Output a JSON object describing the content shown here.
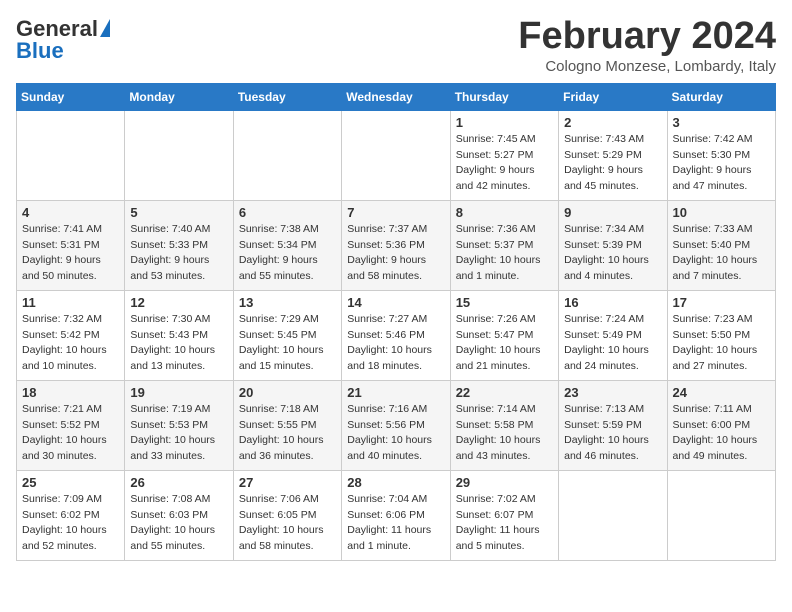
{
  "header": {
    "logo_general": "General",
    "logo_blue": "Blue",
    "month_title": "February 2024",
    "subtitle": "Cologno Monzese, Lombardy, Italy"
  },
  "days_of_week": [
    "Sunday",
    "Monday",
    "Tuesday",
    "Wednesday",
    "Thursday",
    "Friday",
    "Saturday"
  ],
  "weeks": [
    [
      {
        "day": "",
        "info": ""
      },
      {
        "day": "",
        "info": ""
      },
      {
        "day": "",
        "info": ""
      },
      {
        "day": "",
        "info": ""
      },
      {
        "day": "1",
        "info": "Sunrise: 7:45 AM\nSunset: 5:27 PM\nDaylight: 9 hours\nand 42 minutes."
      },
      {
        "day": "2",
        "info": "Sunrise: 7:43 AM\nSunset: 5:29 PM\nDaylight: 9 hours\nand 45 minutes."
      },
      {
        "day": "3",
        "info": "Sunrise: 7:42 AM\nSunset: 5:30 PM\nDaylight: 9 hours\nand 47 minutes."
      }
    ],
    [
      {
        "day": "4",
        "info": "Sunrise: 7:41 AM\nSunset: 5:31 PM\nDaylight: 9 hours\nand 50 minutes."
      },
      {
        "day": "5",
        "info": "Sunrise: 7:40 AM\nSunset: 5:33 PM\nDaylight: 9 hours\nand 53 minutes."
      },
      {
        "day": "6",
        "info": "Sunrise: 7:38 AM\nSunset: 5:34 PM\nDaylight: 9 hours\nand 55 minutes."
      },
      {
        "day": "7",
        "info": "Sunrise: 7:37 AM\nSunset: 5:36 PM\nDaylight: 9 hours\nand 58 minutes."
      },
      {
        "day": "8",
        "info": "Sunrise: 7:36 AM\nSunset: 5:37 PM\nDaylight: 10 hours\nand 1 minute."
      },
      {
        "day": "9",
        "info": "Sunrise: 7:34 AM\nSunset: 5:39 PM\nDaylight: 10 hours\nand 4 minutes."
      },
      {
        "day": "10",
        "info": "Sunrise: 7:33 AM\nSunset: 5:40 PM\nDaylight: 10 hours\nand 7 minutes."
      }
    ],
    [
      {
        "day": "11",
        "info": "Sunrise: 7:32 AM\nSunset: 5:42 PM\nDaylight: 10 hours\nand 10 minutes."
      },
      {
        "day": "12",
        "info": "Sunrise: 7:30 AM\nSunset: 5:43 PM\nDaylight: 10 hours\nand 13 minutes."
      },
      {
        "day": "13",
        "info": "Sunrise: 7:29 AM\nSunset: 5:45 PM\nDaylight: 10 hours\nand 15 minutes."
      },
      {
        "day": "14",
        "info": "Sunrise: 7:27 AM\nSunset: 5:46 PM\nDaylight: 10 hours\nand 18 minutes."
      },
      {
        "day": "15",
        "info": "Sunrise: 7:26 AM\nSunset: 5:47 PM\nDaylight: 10 hours\nand 21 minutes."
      },
      {
        "day": "16",
        "info": "Sunrise: 7:24 AM\nSunset: 5:49 PM\nDaylight: 10 hours\nand 24 minutes."
      },
      {
        "day": "17",
        "info": "Sunrise: 7:23 AM\nSunset: 5:50 PM\nDaylight: 10 hours\nand 27 minutes."
      }
    ],
    [
      {
        "day": "18",
        "info": "Sunrise: 7:21 AM\nSunset: 5:52 PM\nDaylight: 10 hours\nand 30 minutes."
      },
      {
        "day": "19",
        "info": "Sunrise: 7:19 AM\nSunset: 5:53 PM\nDaylight: 10 hours\nand 33 minutes."
      },
      {
        "day": "20",
        "info": "Sunrise: 7:18 AM\nSunset: 5:55 PM\nDaylight: 10 hours\nand 36 minutes."
      },
      {
        "day": "21",
        "info": "Sunrise: 7:16 AM\nSunset: 5:56 PM\nDaylight: 10 hours\nand 40 minutes."
      },
      {
        "day": "22",
        "info": "Sunrise: 7:14 AM\nSunset: 5:58 PM\nDaylight: 10 hours\nand 43 minutes."
      },
      {
        "day": "23",
        "info": "Sunrise: 7:13 AM\nSunset: 5:59 PM\nDaylight: 10 hours\nand 46 minutes."
      },
      {
        "day": "24",
        "info": "Sunrise: 7:11 AM\nSunset: 6:00 PM\nDaylight: 10 hours\nand 49 minutes."
      }
    ],
    [
      {
        "day": "25",
        "info": "Sunrise: 7:09 AM\nSunset: 6:02 PM\nDaylight: 10 hours\nand 52 minutes."
      },
      {
        "day": "26",
        "info": "Sunrise: 7:08 AM\nSunset: 6:03 PM\nDaylight: 10 hours\nand 55 minutes."
      },
      {
        "day": "27",
        "info": "Sunrise: 7:06 AM\nSunset: 6:05 PM\nDaylight: 10 hours\nand 58 minutes."
      },
      {
        "day": "28",
        "info": "Sunrise: 7:04 AM\nSunset: 6:06 PM\nDaylight: 11 hours\nand 1 minute."
      },
      {
        "day": "29",
        "info": "Sunrise: 7:02 AM\nSunset: 6:07 PM\nDaylight: 11 hours\nand 5 minutes."
      },
      {
        "day": "",
        "info": ""
      },
      {
        "day": "",
        "info": ""
      }
    ]
  ]
}
